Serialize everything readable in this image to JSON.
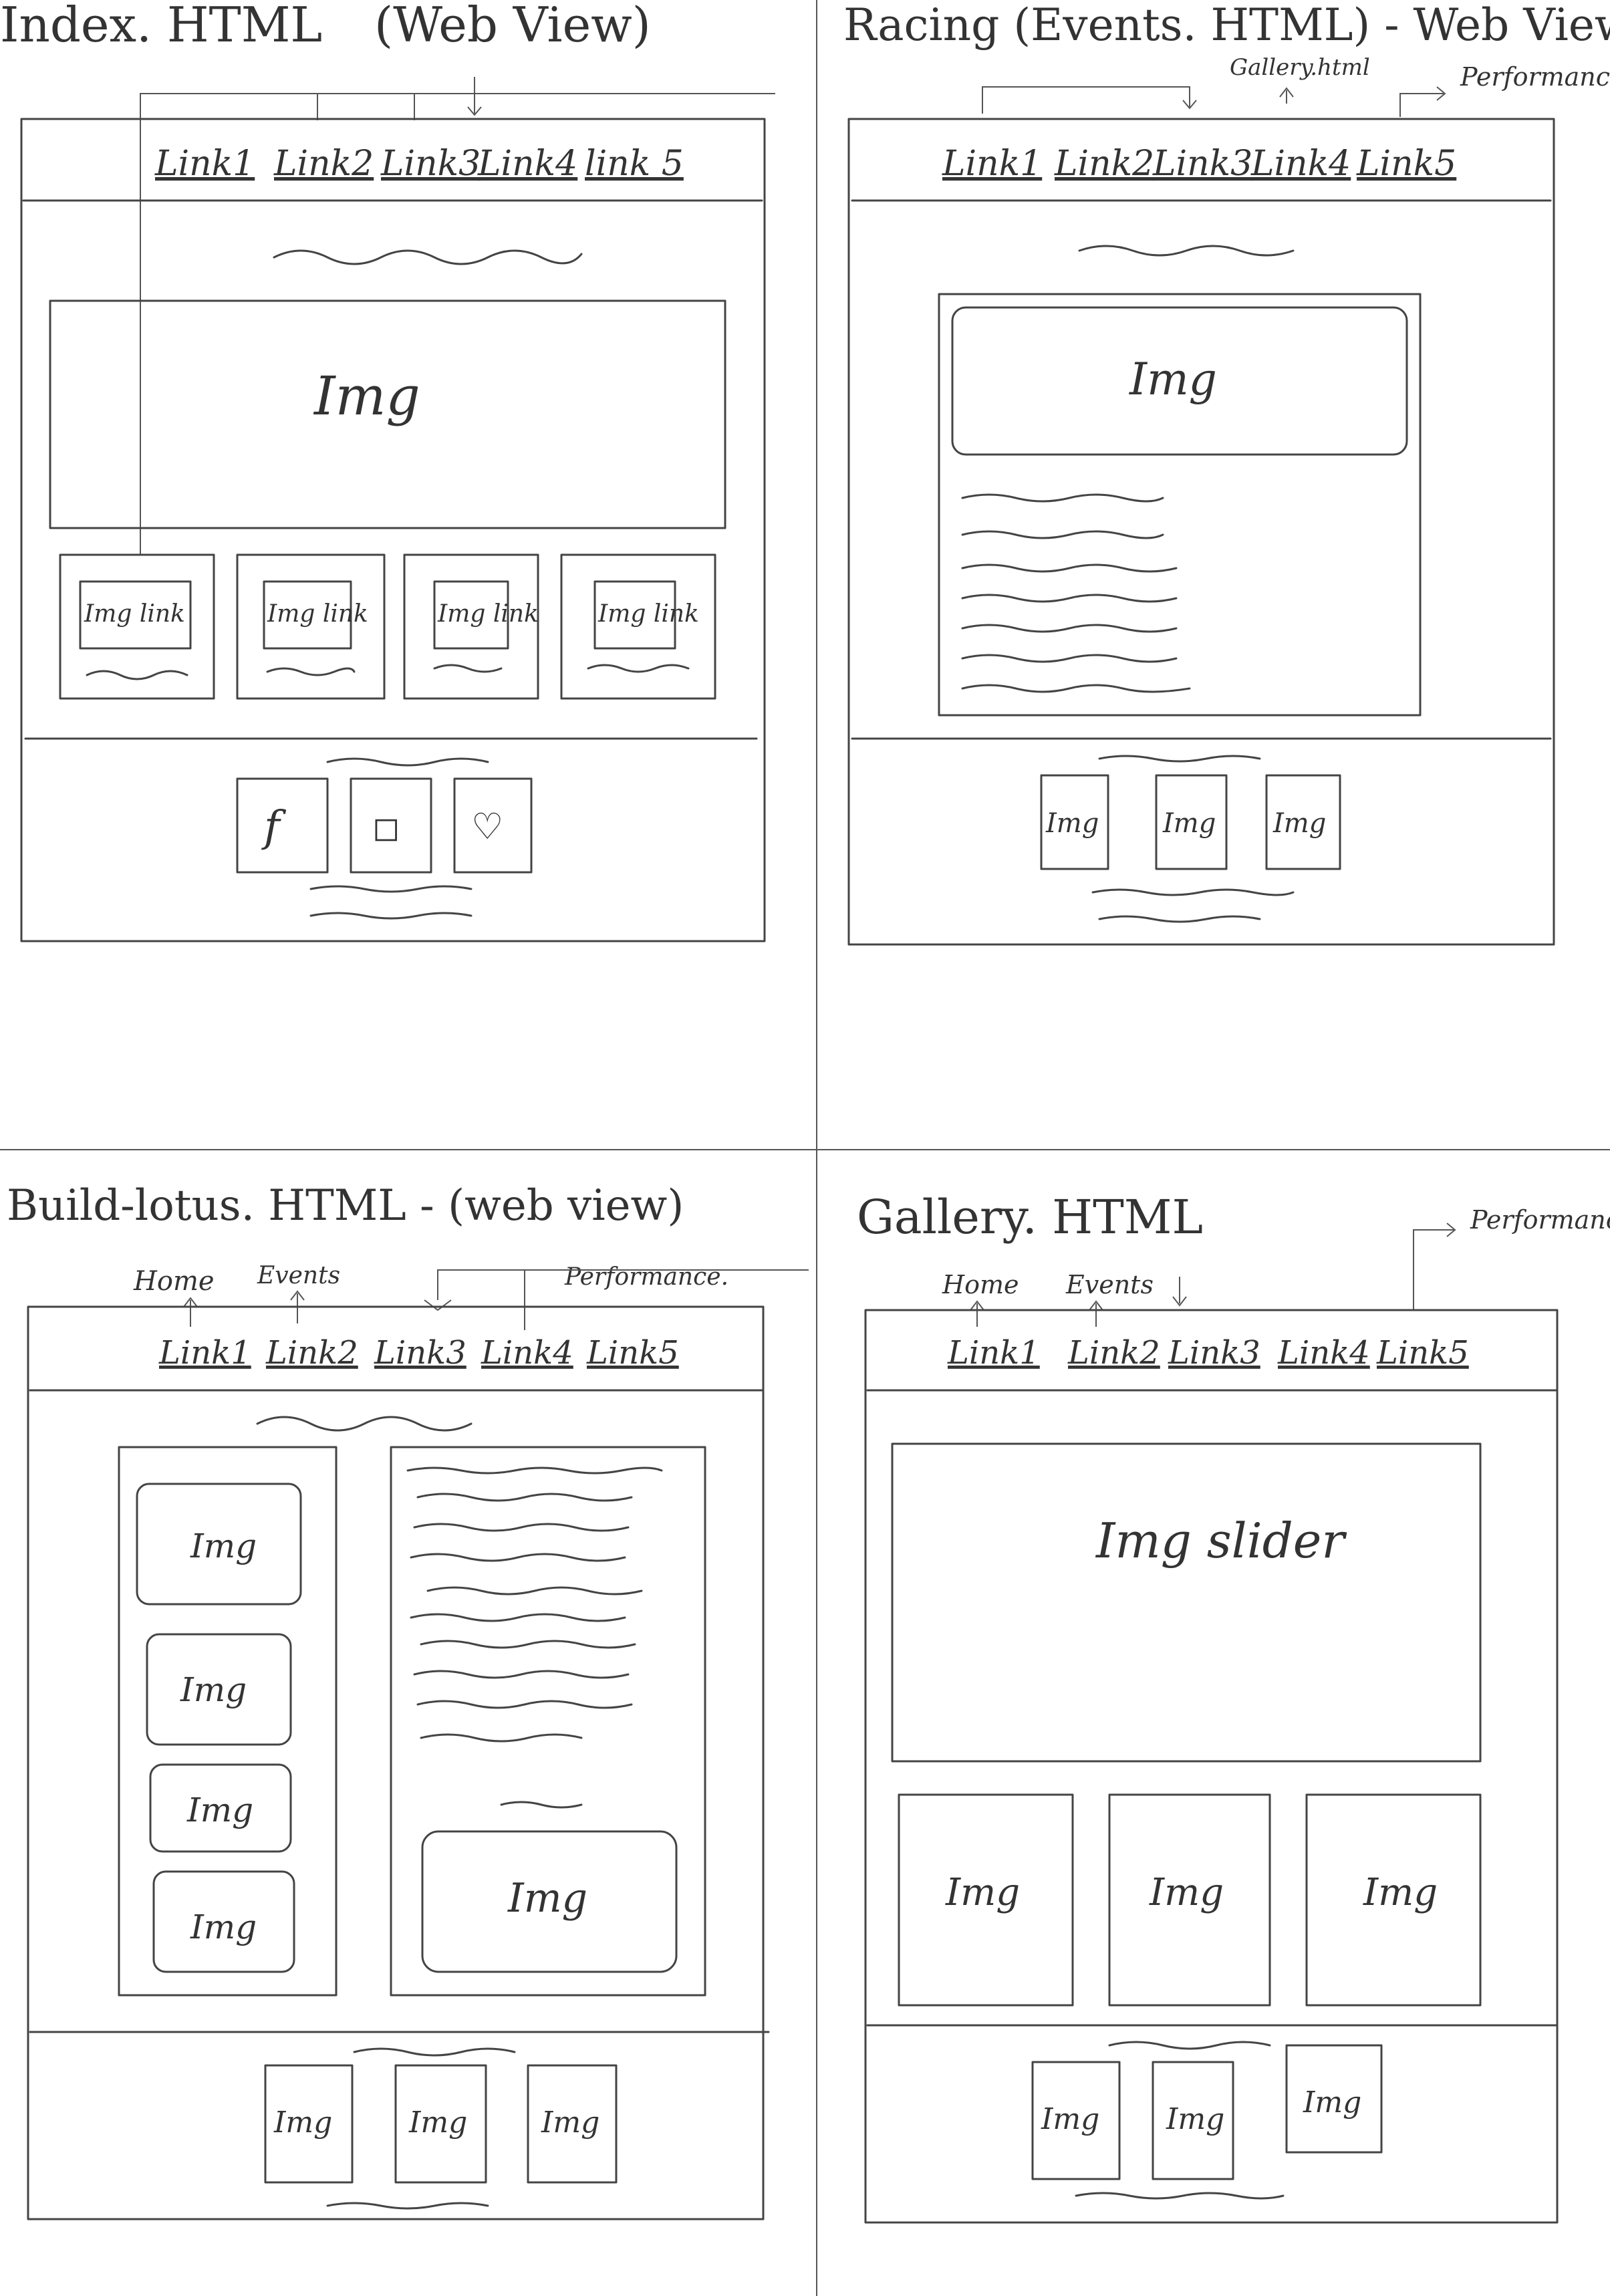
{
  "pages": {
    "index": {
      "title": "Index. HTML",
      "subtitle": "(Web View)",
      "nav": [
        "Link1",
        "Link2",
        "Link3",
        "Link4",
        "link 5"
      ],
      "hero": "Img",
      "cards": [
        "Img link",
        "Img link",
        "Img link",
        "Img link"
      ],
      "social": [
        "f",
        "◻",
        "♡"
      ]
    },
    "racing": {
      "title": "Racing (Events. HTML) - Web View",
      "annotations": [
        "Gallery.html",
        "Performance html"
      ],
      "nav": [
        "Link1",
        "Link2",
        "Link3",
        "Link4",
        "Link5"
      ],
      "hero": "Img",
      "footer_imgs": [
        "Img",
        "Img",
        "Img"
      ]
    },
    "buildlotus": {
      "title": "Build-lotus. HTML - (web view)",
      "annotations": [
        "Home",
        "Events",
        "Performance."
      ],
      "nav": [
        "Link1",
        "Link2",
        "Link3",
        "Link4",
        "Link5"
      ],
      "side_imgs": [
        "Img",
        "Img",
        "Img",
        "Img"
      ],
      "content_img": "Img",
      "footer_imgs": [
        "Img",
        "Img",
        "Img"
      ]
    },
    "gallery": {
      "title": "Gallery. HTML",
      "annotations": [
        "Home",
        "Events",
        "Performance html"
      ],
      "nav": [
        "Link1",
        "Link2",
        "Link3",
        "Link4",
        "Link5"
      ],
      "slider": "Img slider",
      "thumbs": [
        "Img",
        "Img",
        "Img"
      ],
      "footer_imgs": [
        "Img",
        "Img",
        "Img"
      ]
    }
  }
}
